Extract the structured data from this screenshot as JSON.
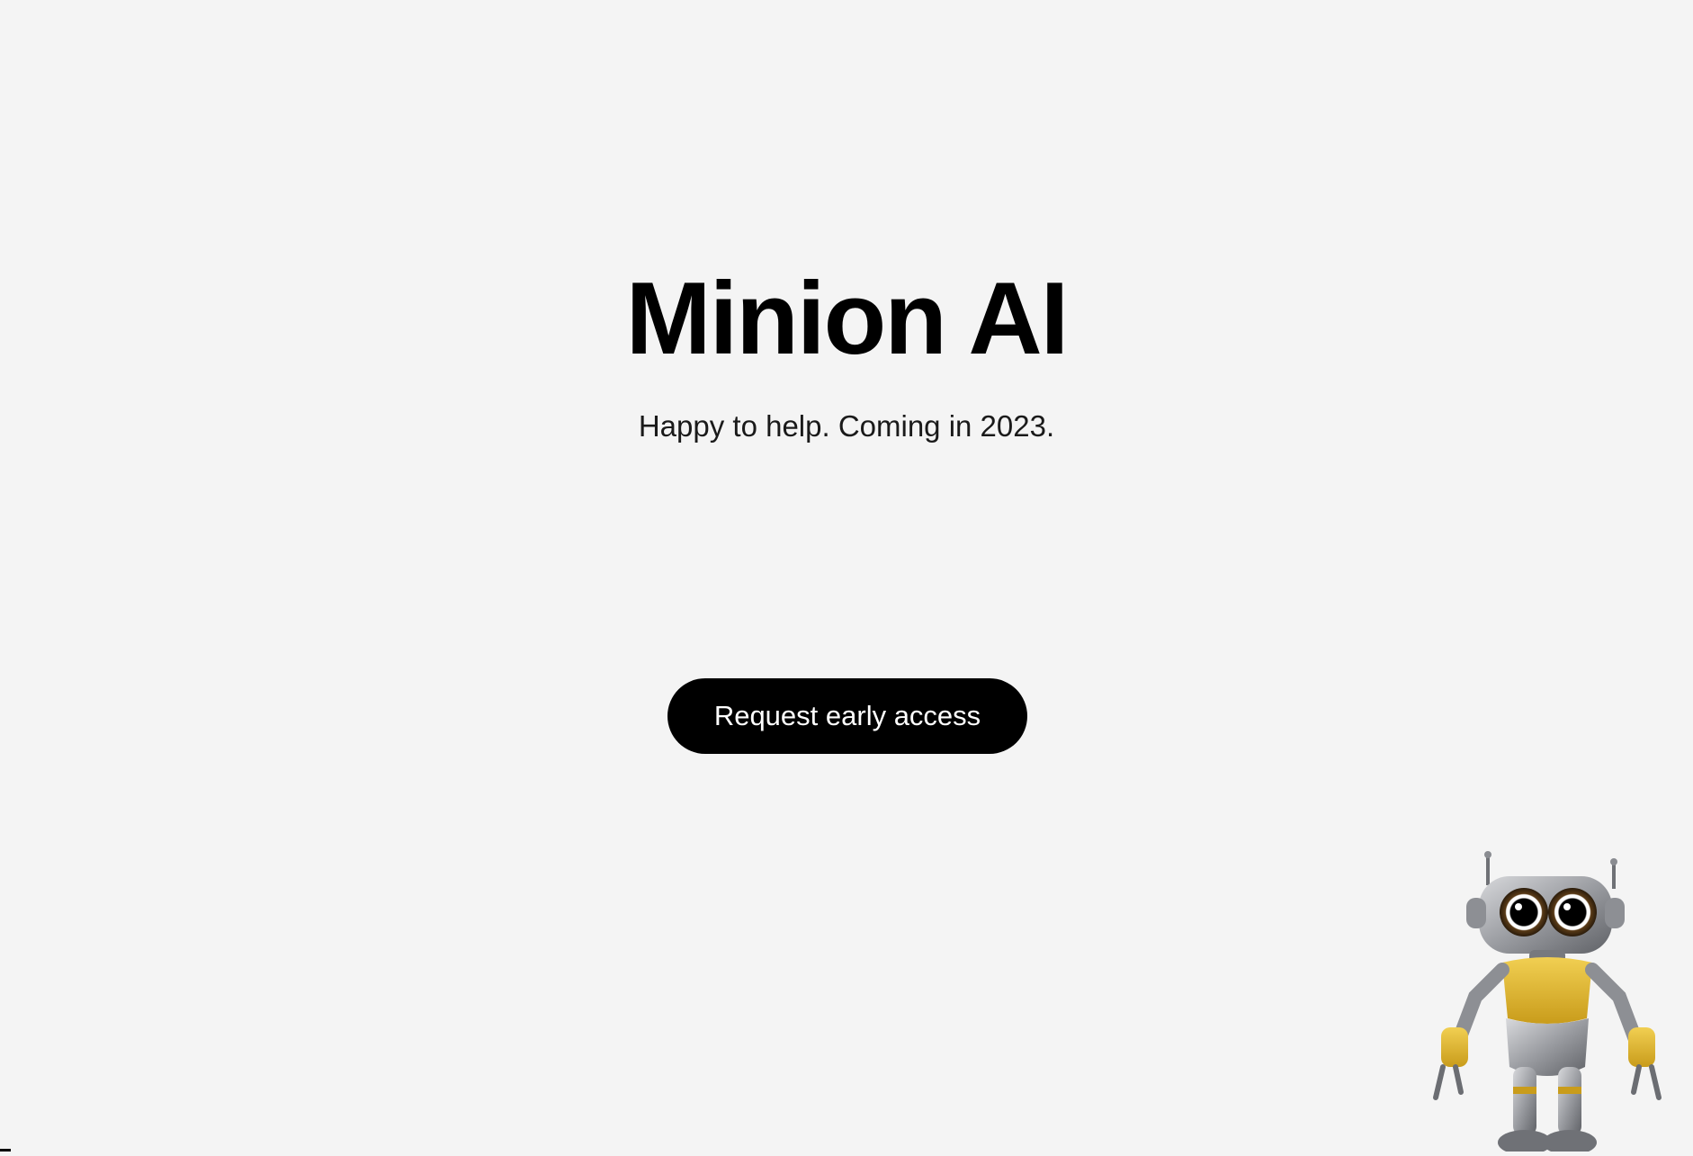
{
  "hero": {
    "title": "Minion AI",
    "subtitle": "Happy to help. Coming in 2023.",
    "cta_label": "Request early access"
  },
  "mascot": {
    "icon": "robot-mascot-icon",
    "colors": {
      "body_yellow": "#e2b62f",
      "metal": "#a7a9ad"
    }
  },
  "colors": {
    "background": "#f4f4f4",
    "button": "#000000",
    "button_text": "#ffffff"
  }
}
